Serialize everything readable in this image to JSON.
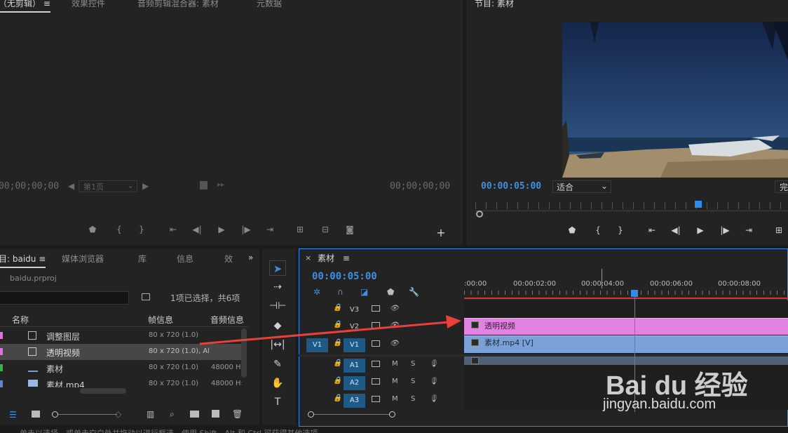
{
  "source_panel": {
    "tabs": [
      "（无剪辑）",
      "效果控件",
      "音频剪辑混合器: 素材",
      "元数据"
    ],
    "menu_glyph": "≡",
    "timecode_left": "00;00;00;00",
    "timecode_right": "00;00;00;00",
    "page_select": "第1页"
  },
  "program_panel": {
    "title": "节目: 素材",
    "timecode": "00:00:05:00",
    "fit_select": "适合",
    "quality_select": "完"
  },
  "project_panel": {
    "tabs": [
      "目: baidu",
      "媒体浏览器",
      "库",
      "信息",
      "效"
    ],
    "project_file": "baidu.prproj",
    "selection_info": "1项已选择，共6项",
    "columns": [
      "名称",
      "帧信息",
      "音频信息"
    ],
    "rows": [
      {
        "name": "调整图层",
        "frame": "80 x 720 (1.0)",
        "audio": "",
        "color": "#e070e0"
      },
      {
        "name": "透明视频",
        "frame": "80 x 720 (1.0), Al",
        "audio": "",
        "color": "#e070e0"
      },
      {
        "name": "素材",
        "frame": "80 x 720 (1.0)",
        "audio": "48000 H:",
        "color": "#2fb64a"
      },
      {
        "name": "素材.mp4",
        "frame": "80 x 720 (1.0)",
        "audio": "48000 H:",
        "color": "#5f86d6"
      }
    ]
  },
  "timeline": {
    "sequence_name": "素材",
    "timecode": "00:00:05:00",
    "ruler_labels": [
      ":00:00",
      "00:00:02:00",
      "00:00:04:00",
      "00:00:06:00",
      "00:00:08:00"
    ],
    "video_tracks": [
      {
        "name": "V3",
        "source": ""
      },
      {
        "name": "V2",
        "source": ""
      },
      {
        "name": "V1",
        "source": "V1"
      }
    ],
    "audio_tracks": [
      {
        "name": "A1",
        "m": "M",
        "s": "S"
      },
      {
        "name": "A2",
        "m": "M",
        "s": "S"
      },
      {
        "name": "A3",
        "m": "M",
        "s": "S"
      }
    ],
    "clips": {
      "v2": "透明视频",
      "v1": "素材.mp4 [V]"
    }
  },
  "watermark": {
    "brand": "Bai du 经验",
    "url": "jingyan.baidu.com"
  },
  "status_bar": "单击以选择，或单击空白处并拖动以进行框选。使用 Shift、Alt 和 Ctrl 可获得其他选项。",
  "colors": {
    "accent": "#2d8ceb",
    "clip_pink": "#e283e2",
    "clip_blue": "#7aa2d6",
    "arrow": "#e8413b"
  }
}
